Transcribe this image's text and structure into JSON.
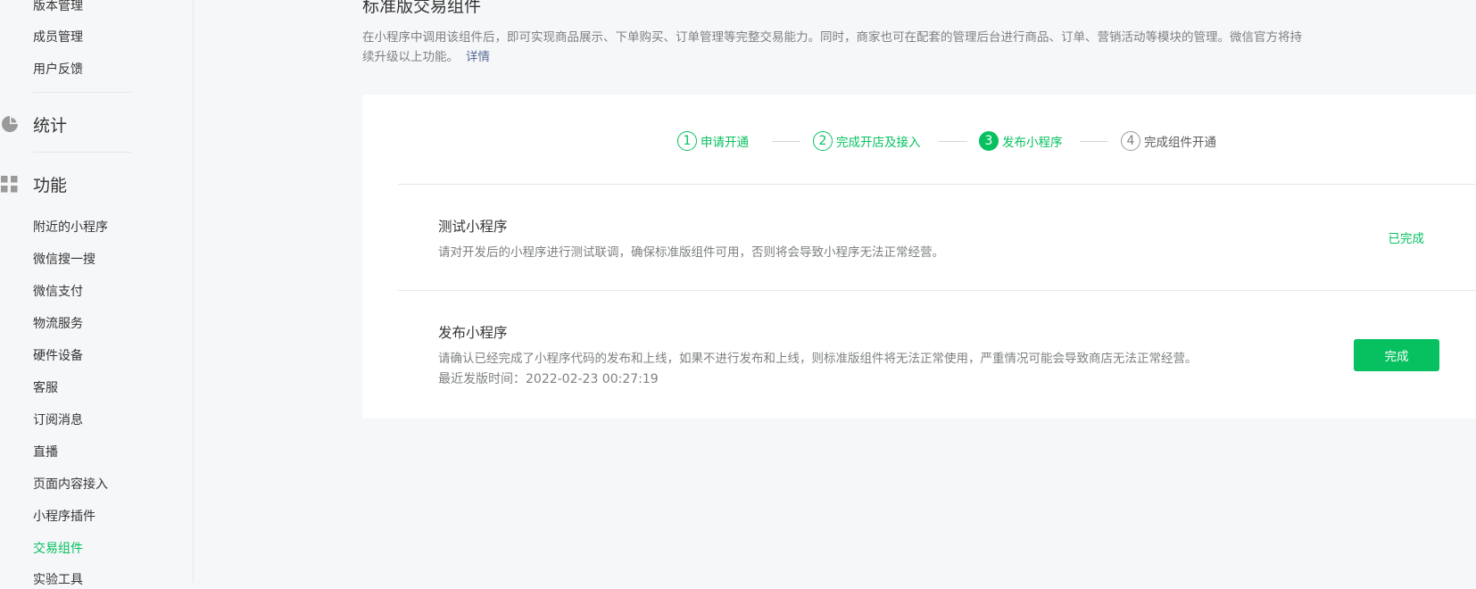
{
  "sidebar": {
    "top_items": [
      "版本管理",
      "成员管理",
      "用户反馈"
    ],
    "stats_label": "统计",
    "features_label": "功能",
    "feature_items": [
      "附近的小程序",
      "微信搜一搜",
      "微信支付",
      "物流服务",
      "硬件设备",
      "客服",
      "订阅消息",
      "直播",
      "页面内容接入",
      "小程序插件",
      "交易组件",
      "实验工具"
    ],
    "active_item": "交易组件"
  },
  "main": {
    "title": "标准版交易组件",
    "description": "在小程序中调用该组件后，即可实现商品展示、下单购买、订单管理等完整交易能力。同时，商家也可在配套的管理后台进行商品、订单、营销活动等模块的管理。微信官方将持续升级以上功能。",
    "details_link": "详情",
    "steps": [
      {
        "num": "1",
        "label": "申请开通",
        "state": "done"
      },
      {
        "num": "2",
        "label": "完成开店及接入",
        "state": "done"
      },
      {
        "num": "3",
        "label": "发布小程序",
        "state": "current"
      },
      {
        "num": "4",
        "label": "完成组件开通",
        "state": "todo"
      }
    ],
    "tasks": [
      {
        "title": "测试小程序",
        "desc": "请对开发后的小程序进行测试联调，确保标准版组件可用，否则将会导致小程序无法正常经营。",
        "status": "已完成"
      },
      {
        "title": "发布小程序",
        "desc": "请确认已经完成了小程序代码的发布和上线，如果不进行发布和上线，则标准版组件将无法正常使用，严重情况可能会导致商店无法正常经营。",
        "extra": "最近发版时间：2022-02-23 00:27:19",
        "button": "完成"
      }
    ]
  },
  "colors": {
    "accent": "#07c160",
    "link": "#576b95"
  },
  "icons": {
    "stats": "pie-chart-icon",
    "features": "grid-icon"
  }
}
